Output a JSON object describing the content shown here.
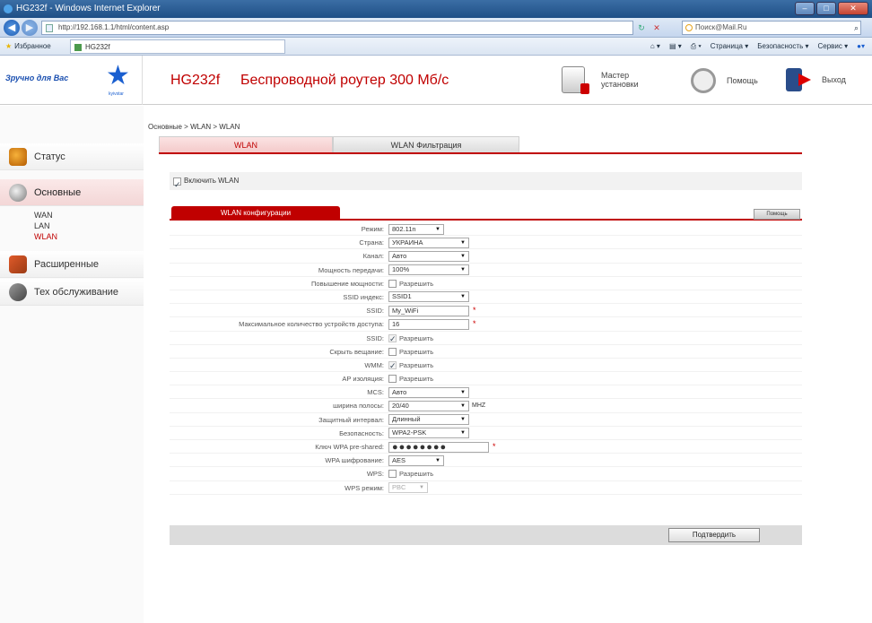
{
  "browser": {
    "title": "HG232f - Windows Internet Explorer",
    "address": "http://192.168.1.1/html/content.asp",
    "search_placeholder": "Поиск@Mail.Ru",
    "favorites_label": "Избранное",
    "tab_label": "HG232f",
    "commands": [
      "Страница ▾",
      "Безопасность ▾",
      "Сервис ▾"
    ]
  },
  "header": {
    "logo_text": "Зручно для Вас",
    "logo_sub": "kyivstar",
    "model": "HG232f",
    "description": "Беспроводной роутер 300 Мб/с",
    "wizard_label": "Мастер установки",
    "help_label": "Помощь",
    "exit_label": "Выход"
  },
  "sidebar": {
    "items": [
      {
        "label": "Статус",
        "icon": "status-icon"
      },
      {
        "label": "Основные",
        "icon": "basic-settings-icon",
        "active": true
      },
      {
        "label": "Расширенные",
        "icon": "advanced-icon"
      },
      {
        "label": "Тех обслуживание",
        "icon": "maintenance-icon"
      }
    ],
    "sub_items": [
      "WAN",
      "LAN",
      "WLAN"
    ]
  },
  "breadcrumb": "Основные > WLAN > WLAN",
  "tabs": [
    {
      "label": "WLAN",
      "active": true
    },
    {
      "label": "WLAN Фильтрация",
      "active": false
    }
  ],
  "enable_wlan": {
    "label": "Включить WLAN",
    "checked": true
  },
  "config": {
    "tab_label": "WLAN конфигурации",
    "help_label": "Помощь",
    "rows": [
      {
        "label": "Режим:",
        "type": "select",
        "value": "802.11n"
      },
      {
        "label": "Страна:",
        "type": "select",
        "value": "УКРАИНА"
      },
      {
        "label": "Канал:",
        "type": "select",
        "value": "Авто"
      },
      {
        "label": "Мощность передачи:",
        "type": "select",
        "value": "100%"
      },
      {
        "label": "Повышение мощности:",
        "type": "checkbox",
        "value": "Разрешить"
      },
      {
        "label": "SSID индекс:",
        "type": "select",
        "value": "SSID1"
      },
      {
        "label": "SSID:",
        "type": "input",
        "value": "My_WiFi"
      },
      {
        "label": "Максимальное количество устройств доступа:",
        "type": "input",
        "value": "16"
      },
      {
        "label": "SSID:",
        "type": "checkbox-disabled",
        "value": "Разрешить"
      },
      {
        "label": "Скрыть вещание:",
        "type": "checkbox",
        "value": "Разрешить"
      },
      {
        "label": "WMM:",
        "type": "checkbox-disabled",
        "value": "Разрешить"
      },
      {
        "label": "AP изоляция:",
        "type": "checkbox",
        "value": "Разрешить"
      },
      {
        "label": "MCS:",
        "type": "select",
        "value": "Авто"
      },
      {
        "label": "ширина полосы:",
        "type": "select",
        "value": "20/40",
        "unit": "MHZ"
      },
      {
        "label": "Защитный интервал:",
        "type": "select",
        "value": "Длинный"
      },
      {
        "label": "Безопасность:",
        "type": "select",
        "value": "WPA2-PSK"
      },
      {
        "label": "Ключ WPA pre-shared:",
        "type": "password",
        "value": "●●●●●●●●"
      },
      {
        "label": "WPA шифрование:",
        "type": "select",
        "value": "AES"
      },
      {
        "label": "WPS:",
        "type": "checkbox",
        "value": "Разрешить"
      },
      {
        "label": "WPS режим:",
        "type": "select-disabled",
        "value": "PBC"
      }
    ],
    "submit_label": "Подтвердить"
  }
}
